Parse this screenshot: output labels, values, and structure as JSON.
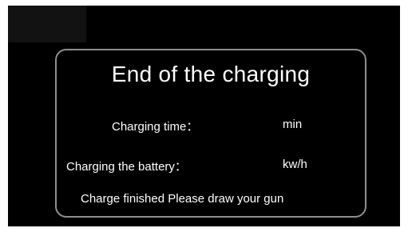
{
  "dialog": {
    "title": "End of the charging",
    "charging_time": {
      "label": "Charging time：",
      "unit": "min"
    },
    "charging_battery": {
      "label": "Charging the battery：",
      "unit": "kw/h"
    },
    "message": "Charge finished Please draw your gun"
  }
}
